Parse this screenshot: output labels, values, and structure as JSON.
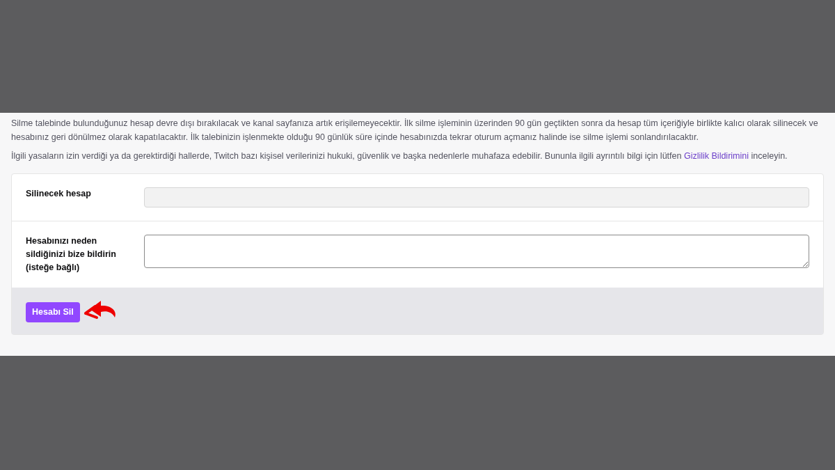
{
  "notice": "Silme talebinde bulunduğunuz hesap devre dışı bırakılacak ve kanal sayfanıza artık erişilemeyecektir. İlk silme işleminin üzerinden 90 gün geçtikten sonra da hesap tüm içeriğiyle birlikte kalıcı olarak silinecek ve hesabınız geri dönülmez olarak kapatılacaktır. İlk talebinizin işlenmekte olduğu 90 günlük süre içinde hesabınızda tekrar oturum açmanız halinde ise silme işlemi sonlandırılacaktır.",
  "privacy": {
    "before": "İlgili yasaların izin verdiği ya da gerektirdiği hallerde, Twitch bazı kişisel verilerinizi hukuki, güvenlik ve başka nedenlerle muhafaza edebilir. Bununla ilgili ayrıntılı bilgi için lütfen",
    "link": "Gizlilik Bildirimini",
    "after": "inceleyin."
  },
  "form": {
    "fields": [
      {
        "label": "Silinecek hesap",
        "kind": "readonly"
      },
      {
        "label": "Hesabınızı neden sildiğinizi bize bildirin (isteğe bağlı)",
        "kind": "textarea"
      }
    ],
    "submit": "Hesabı Sil"
  }
}
